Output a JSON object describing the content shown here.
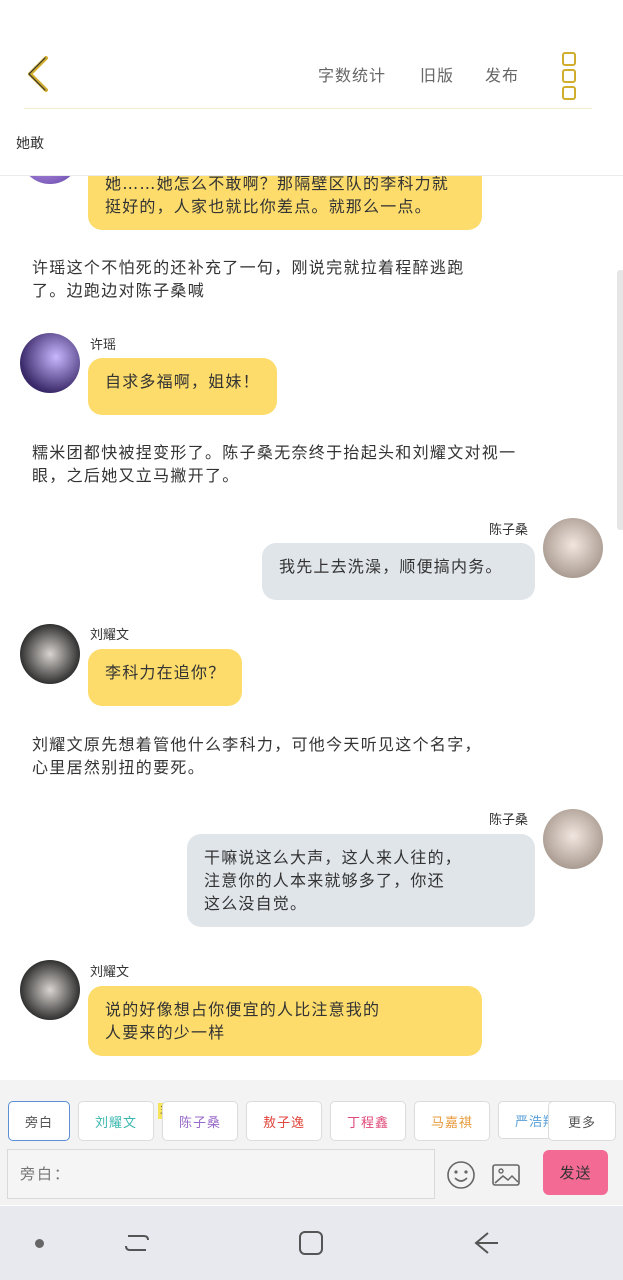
{
  "header": {
    "back_label": "back",
    "actions": [
      "字数统计",
      "旧版",
      "发布"
    ],
    "novel_title": "她敢"
  },
  "chat": {
    "top_bubble": "她……她怎么不敢啊？那隔壁区队的李科力就挺好的，人家也就比你差点。就那么一点。",
    "top_bubble_line1": "她……她怎么不敢啊？那隔壁区队的李科力就",
    "top_bubble_line2": "挺好的，人家也就比你差点。就那么一点。",
    "narration1_line1": "许瑶这个不怕死的还补充了一句，刚说完就拉着程醉逃跑",
    "narration1_line2": "了。边跑边对陈子桑喊",
    "msg1_speaker": "许瑶",
    "msg1_text": "自求多福啊，姐妹！",
    "narration2_line1": "糯米团都快被捏变形了。陈子桑无奈终于抬起头和刘耀文对视一",
    "narration2_line2": "眼，之后她又立马撇开了。",
    "msg2_speaker": "陈子桑",
    "msg2_text": "我先上去洗澡，顺便搞内务。",
    "msg3_speaker": "刘耀文",
    "msg3_text": "李科力在追你？",
    "narration3_line1": "刘耀文原先想着管他什么李科力，可他今天听见这个名字，",
    "narration3_line2": "心里居然别扭的要死。",
    "msg4_speaker": "陈子桑",
    "msg4_line1": "干嘛说这么大声，这人来人往的，",
    "msg4_line2": "注意你的人本来就够多了，你还",
    "msg4_line3": "这么没自觉。",
    "msg5_speaker": "刘耀文",
    "msg5_line1": "说的好像想占你便宜的人比注意我的",
    "msg5_line2": "人要来的少一样"
  },
  "composer": {
    "roles": [
      "旁白",
      "刘耀文",
      "陈子桑",
      "敖子逸",
      "丁程鑫",
      "马嘉祺",
      "严浩翔"
    ],
    "role_colors": [
      "#555555",
      "#3bb8b0",
      "#9a6cc9",
      "#e0463c",
      "#e04a7a",
      "#e89b3c",
      "#5aa0d8"
    ],
    "main_badge": "主",
    "more_label": "更多",
    "input_placeholder": "旁白：",
    "send_label": "发送",
    "emoji_icon": "smiley-icon",
    "image_icon": "image-icon",
    "send_color": "#f36a95",
    "accent_color": "#fddc6c"
  }
}
